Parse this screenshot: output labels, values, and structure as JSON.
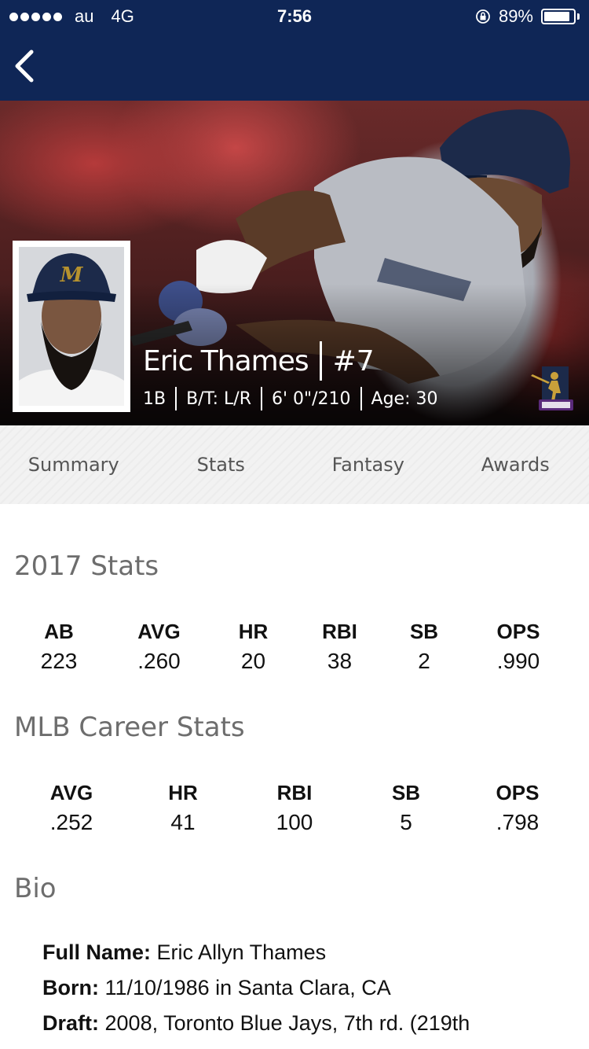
{
  "status_bar": {
    "carrier": "au",
    "network": "4G",
    "time": "7:56",
    "battery": "89%",
    "battery_level": 0.89,
    "signal_dots": 5
  },
  "player": {
    "name": "Eric Thames",
    "number": "#7",
    "position": "1B",
    "bats_throws": "B/T: L/R",
    "height_weight": "6' 0\"/210",
    "age": "Age: 30",
    "team_colors": {
      "navy": "#0f2656",
      "gold": "#b6922e"
    }
  },
  "tabs": [
    {
      "label": "Summary"
    },
    {
      "label": "Stats"
    },
    {
      "label": "Fantasy"
    },
    {
      "label": "Awards"
    }
  ],
  "season_stats": {
    "title": "2017 Stats",
    "headers": [
      "AB",
      "AVG",
      "HR",
      "RBI",
      "SB",
      "OPS"
    ],
    "values": [
      "223",
      ".260",
      "20",
      "38",
      "2",
      ".990"
    ]
  },
  "career_stats": {
    "title": "MLB Career Stats",
    "headers": [
      "AVG",
      "HR",
      "RBI",
      "SB",
      "OPS"
    ],
    "values": [
      ".252",
      "41",
      "100",
      "5",
      ".798"
    ]
  },
  "bio": {
    "title": "Bio",
    "full_name_label": "Full Name:",
    "full_name": "Eric Allyn Thames",
    "born_label": "Born:",
    "born": "11/10/1986 in Santa Clara, CA",
    "draft_label": "Draft:",
    "draft": "2008, Toronto Blue Jays, 7th rd. (219th"
  }
}
